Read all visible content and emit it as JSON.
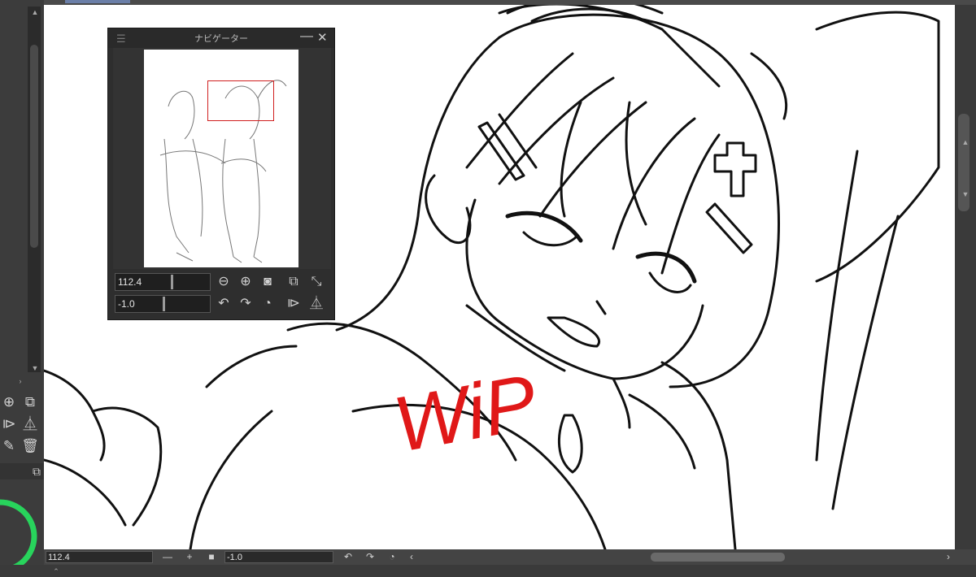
{
  "navigator": {
    "title": "ナビゲーター",
    "zoom_value": "112.4",
    "rotation_value": "-1.0"
  },
  "statusbar": {
    "zoom_value": "112.4",
    "rotation_value": "-1.0"
  },
  "canvas": {
    "annotation_text": "WiP",
    "annotation_color": "#e01818"
  },
  "icons": {
    "nav_menu": "hamburger-icon",
    "nav_minimize": "minimize-icon",
    "nav_close": "close-icon",
    "zoom_out": "zoom-out-icon",
    "zoom_in": "zoom-in-icon",
    "fit": "fit-icon",
    "actual_size": "actual-size-icon",
    "fullscreen": "fullscreen-icon",
    "rotate_left": "rotate-left-icon",
    "rotate_right": "rotate-right-icon",
    "reset_rotation": "reset-rotation-icon",
    "flip_horizontal": "flip-horizontal-icon",
    "flip_vertical": "flip-vertical-icon"
  }
}
